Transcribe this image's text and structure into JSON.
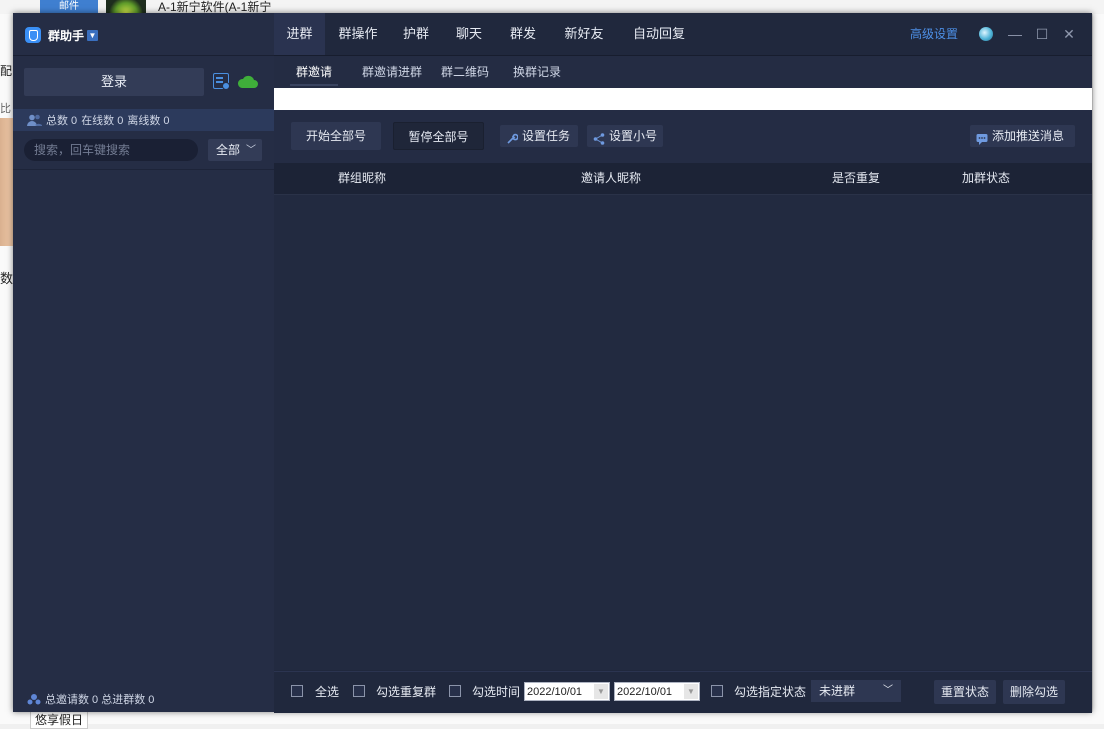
{
  "background": {
    "tab_label": "邮件",
    "title": "A-1新宁软件(A-1新宁",
    "left_text_1": "配",
    "left_text_2": "比",
    "left_text_3": "数",
    "bottom_text": "悠享假日"
  },
  "sidebar": {
    "brand": "群助手",
    "login_label": "登录",
    "stats": {
      "total": "总数 0",
      "online": "在线数 0",
      "offline": "离线数 0"
    },
    "search_placeholder": "搜索，回车键搜索",
    "filter_value": "全部",
    "footer": "总邀请数 0 总进群数 0"
  },
  "topnav": {
    "tabs": [
      "进群",
      "群操作",
      "护群",
      "聊天",
      "群发",
      "新好友",
      "自动回复"
    ],
    "active": "进群",
    "advanced": "高级设置"
  },
  "subnav": {
    "tabs": [
      "群邀请",
      "群邀请进群",
      "群二维码",
      "换群记录"
    ],
    "active": "群邀请"
  },
  "toolbar": {
    "start_all": "开始全部号",
    "pause_all": "暂停全部号",
    "set_task": "设置任务",
    "set_alt": "设置小号",
    "add_push": "添加推送消息"
  },
  "table": {
    "columns": [
      "群组昵称",
      "邀请人昵称",
      "是否重复",
      "加群状态"
    ],
    "rows": []
  },
  "footer": {
    "select_all": "全选",
    "select_dup": "勾选重复群",
    "select_time": "勾选时间",
    "date_from": "2022/10/01",
    "date_to": "2022/10/01",
    "select_status": "勾选指定状态",
    "status_value": "未进群",
    "reset_status": "重置状态",
    "delete_selected": "删除勾选"
  },
  "colors": {
    "accent": "#3a8ff5",
    "panel": "#20283d",
    "sidebar": "#252d45",
    "cloud": "#3fae3a"
  }
}
